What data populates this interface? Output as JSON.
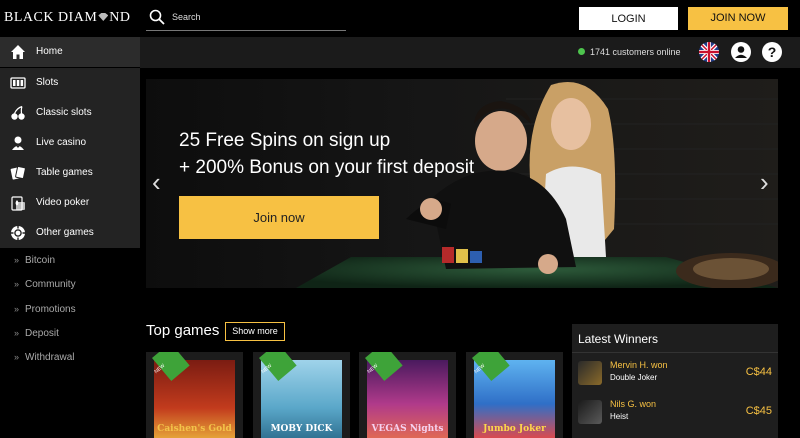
{
  "header": {
    "logo_left": "BLACK DIAM",
    "logo_right": "ND",
    "search_placeholder": "Search",
    "login_label": "LOGIN",
    "join_label": "JOIN NOW"
  },
  "status": {
    "online_text": "1741 customers online"
  },
  "icons": {
    "search": "search-icon",
    "language": "uk-flag-icon",
    "account": "user-icon",
    "help": "help-icon",
    "help_glyph": "?"
  },
  "sidebar": {
    "items": [
      {
        "label": "Home",
        "icon": "home-icon"
      },
      {
        "label": "Slots",
        "icon": "slots-icon"
      },
      {
        "label": "Classic slots",
        "icon": "cherries-icon"
      },
      {
        "label": "Live casino",
        "icon": "dealer-icon"
      },
      {
        "label": "Table games",
        "icon": "cards-icon"
      },
      {
        "label": "Video poker",
        "icon": "poker-icon"
      },
      {
        "label": "Other games",
        "icon": "chip-icon"
      }
    ],
    "links": [
      "Bitcoin",
      "Community",
      "Promotions",
      "Deposit",
      "Withdrawal"
    ],
    "link_chevron": "»"
  },
  "banner": {
    "line1": "25 Free Spins on sign up",
    "line2": "+ 200% Bonus on your first deposit",
    "cta": "Join now",
    "prev": "‹",
    "next": "›"
  },
  "top_games": {
    "title": "Top games",
    "show_more": "Show more",
    "badge": "NEW",
    "games": [
      {
        "name": "Caishen's Gold",
        "color": "#c23b1d"
      },
      {
        "name": "MOBY DICK",
        "color": "#5aa7c9"
      },
      {
        "name": "VEGAS Nights",
        "color": "#b03a8a"
      },
      {
        "name": "Jumbo Joker",
        "color": "#2f6fc7"
      }
    ]
  },
  "winners": {
    "title": "Latest Winners",
    "rows": [
      {
        "who": "Mervin H. won",
        "game": "Double Joker",
        "amount": "C$44"
      },
      {
        "who": "Nils G. won",
        "game": "Heist",
        "amount": "C$45"
      }
    ]
  },
  "colors": {
    "accent": "#f7c143",
    "online_dot": "#4dc44d",
    "new_badge": "#3ea339"
  }
}
